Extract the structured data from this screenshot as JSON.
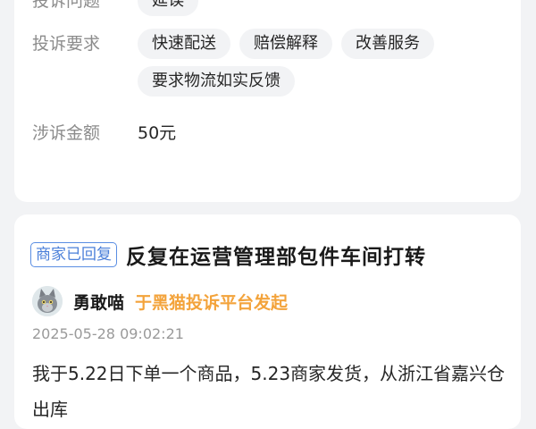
{
  "complaint_details": {
    "issue_label": "投诉问题",
    "issue_chips": [
      "延误"
    ],
    "demand_label": "投诉要求",
    "demand_chips": [
      "快速配送",
      "赔偿解释",
      "改善服务",
      "要求物流如实反馈"
    ],
    "amount_label": "涉诉金额",
    "amount_value": "50元"
  },
  "complaint_post": {
    "badge": "商家已回复",
    "title": "反复在运营管理部包件车间打转",
    "username": "勇敢喵",
    "platform": "于黑猫投诉平台发起",
    "timestamp": "2025-05-28 09:02:21",
    "body": "我于5.22日下单一个商品，5.23商家发货，从浙江省嘉兴仓出库"
  },
  "colors": {
    "badge_blue": "#4a7fd9",
    "platform_orange": "#f3a33b",
    "page_bg": "#f2f3f5"
  }
}
